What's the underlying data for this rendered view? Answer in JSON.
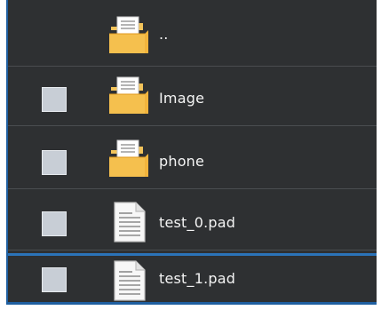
{
  "file_list": {
    "items": [
      {
        "name": "..",
        "type": "parent-folder",
        "has_checkbox": false,
        "icon": "folder-icon"
      },
      {
        "name": "Image",
        "type": "folder",
        "has_checkbox": true,
        "icon": "folder-icon"
      },
      {
        "name": "phone",
        "type": "folder",
        "has_checkbox": true,
        "icon": "folder-icon"
      },
      {
        "name": "test_0.pad",
        "type": "file",
        "has_checkbox": true,
        "icon": "document-icon"
      },
      {
        "name": "test_1.pad",
        "type": "file",
        "has_checkbox": true,
        "icon": "document-icon"
      }
    ]
  },
  "colors": {
    "panel_background": "#2e3032",
    "accent": "#1f5fa0",
    "label_text": "#f4f4f4",
    "checkbox_fill": "#c8ced6",
    "folder_fill": "#f2b43c"
  }
}
